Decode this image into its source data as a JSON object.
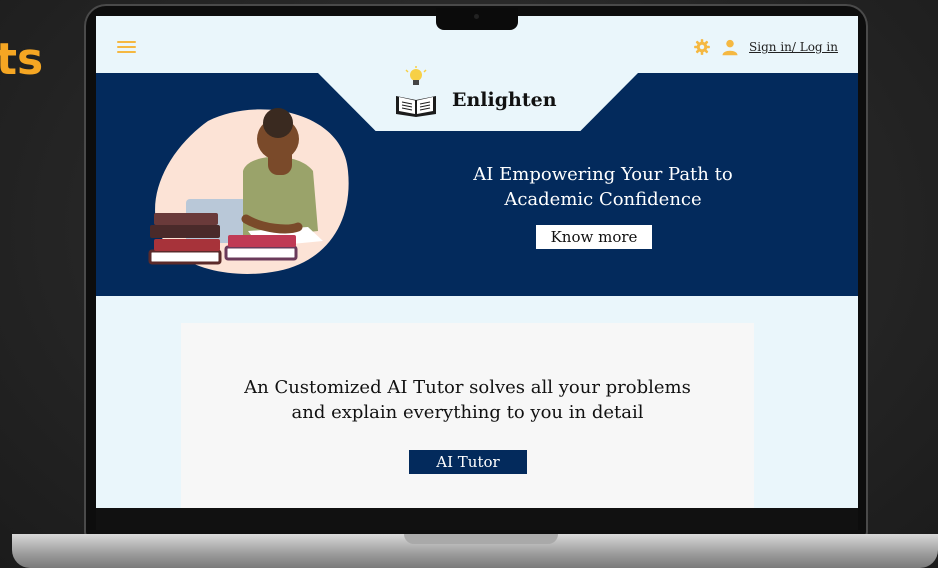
{
  "backdrop": {
    "edge_text": "ts"
  },
  "header": {
    "menu_icon": "hamburger-icon",
    "settings_icon": "gear-icon",
    "user_icon": "user-icon",
    "signin_label": "Sign in/ Log in"
  },
  "brand": {
    "name": "Enlighten",
    "logo_icon": "book-lightbulb-icon"
  },
  "hero": {
    "title_line1": "AI Empowering Your Path to",
    "title_line2": "Academic Confidence",
    "cta_label": "Know more"
  },
  "card": {
    "line1": "An Customized AI Tutor solves all your problems",
    "line2": "and explain everything to you in detail",
    "button_label": "AI Tutor"
  },
  "colors": {
    "navy": "#032a5c",
    "accent": "#f5b841",
    "page_bg": "#eaf6fb",
    "card_bg": "#f7f7f7"
  }
}
